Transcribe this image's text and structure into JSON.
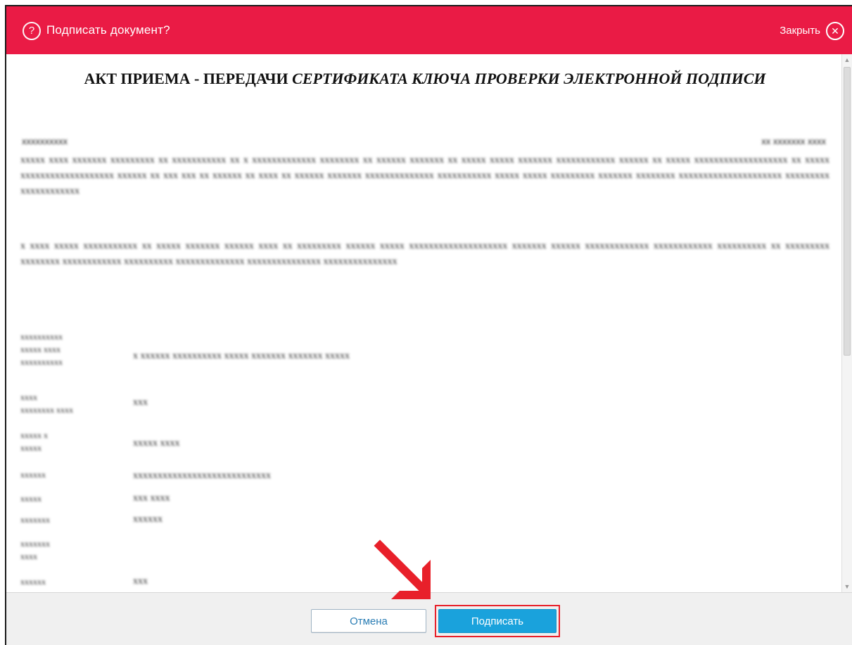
{
  "dialog": {
    "title": "Подписать документ?",
    "close_label": "Закрыть",
    "help_glyph": "?",
    "close_glyph": "✕"
  },
  "document": {
    "title_plain": "АКТ ПРИЕМА - ПЕРЕДАЧИ ",
    "title_italic": "СЕРТИФИКАТА КЛЮЧА ПРОВЕРКИ ЭЛЕКТРОННОЙ ПОДПИСИ",
    "redacted_meta_left": "xxxxxxxxxx",
    "redacted_meta_right": "xx xxxxxxx xxxx",
    "redacted_paragraph_1": "xxxxx xxxx xxxxxxx xxxxxxxxx xx xxxxxxxxxxx xx x xxxxxxxxxxxxx xxxxxxxx xx xxxxxx xxxxxxx xx xxxxx xxxxx xxxxxxx xxxxxxxxxxxx xxxxxx xx xxxxx xxxxxxxxxxxxxxxxxxx xx xxxxx xxxxxxxxxxxxxxxxxxx xxxxxx xx xxx xxx xx xxxxxx xx xxxx xx xxxxxx xxxxxxx xxxxxxxxxxxxxx xxxxxxxxxxx xxxxx xxxxx xxxxxxxxx xxxxxxx xxxxxxxx xxxxxxxxxxxxxxxxxxxxx xxxxxxxxx xxxxxxxxxxxx",
    "redacted_paragraph_2": "x xxxx xxxxx xxxxxxxxxxx xx xxxxx xxxxxxx xxxxxx xxxx xx xxxxxxxxx xxxxxx xxxxx xxxxxxxxxxxxxxxxxxxx xxxxxxx xxxxxx xxxxxxxxxxxxx xxxxxxxxxxxx xxxxxxxxxx xx xxxxxxxxx xxxxxxxx xxxxxxxxxxxx xxxxxxxxxx xxxxxxxxxxxxxx xxxxxxxxxxxxxxx xxxxxxxxxxxxxxx",
    "redacted_fields": [
      {
        "label": "xxxxxxxxxx\nxxxxx xxxx\nxxxxxxxxxx",
        "value": "x xxxxxx xxxxxxxxxx xxxxx xxxxxxx xxxxxxx xxxxx"
      },
      {
        "label": "xxxx\nxxxxxxxx xxxx",
        "value": "xxx"
      },
      {
        "label": "xxxxx x\nxxxxx",
        "value": "xxxxx xxxx"
      },
      {
        "label": "xxxxxx",
        "value": "xxxxxxxxxxxxxxxxxxxxxxxxxxxx"
      },
      {
        "label": "xxxxx",
        "value": "xxx xxxx"
      },
      {
        "label": "xxxxxxx",
        "value": "xxxxxx"
      },
      {
        "label": "xxxxxxx\nxxxx",
        "value": ""
      },
      {
        "label": "xxxxxx",
        "value": "xxx"
      }
    ]
  },
  "footer": {
    "cancel_label": "Отмена",
    "sign_label": "Подписать"
  },
  "colors": {
    "titlebar": "#ea1b45",
    "sign_button": "#1aa2dc",
    "highlight": "#e8202a"
  }
}
